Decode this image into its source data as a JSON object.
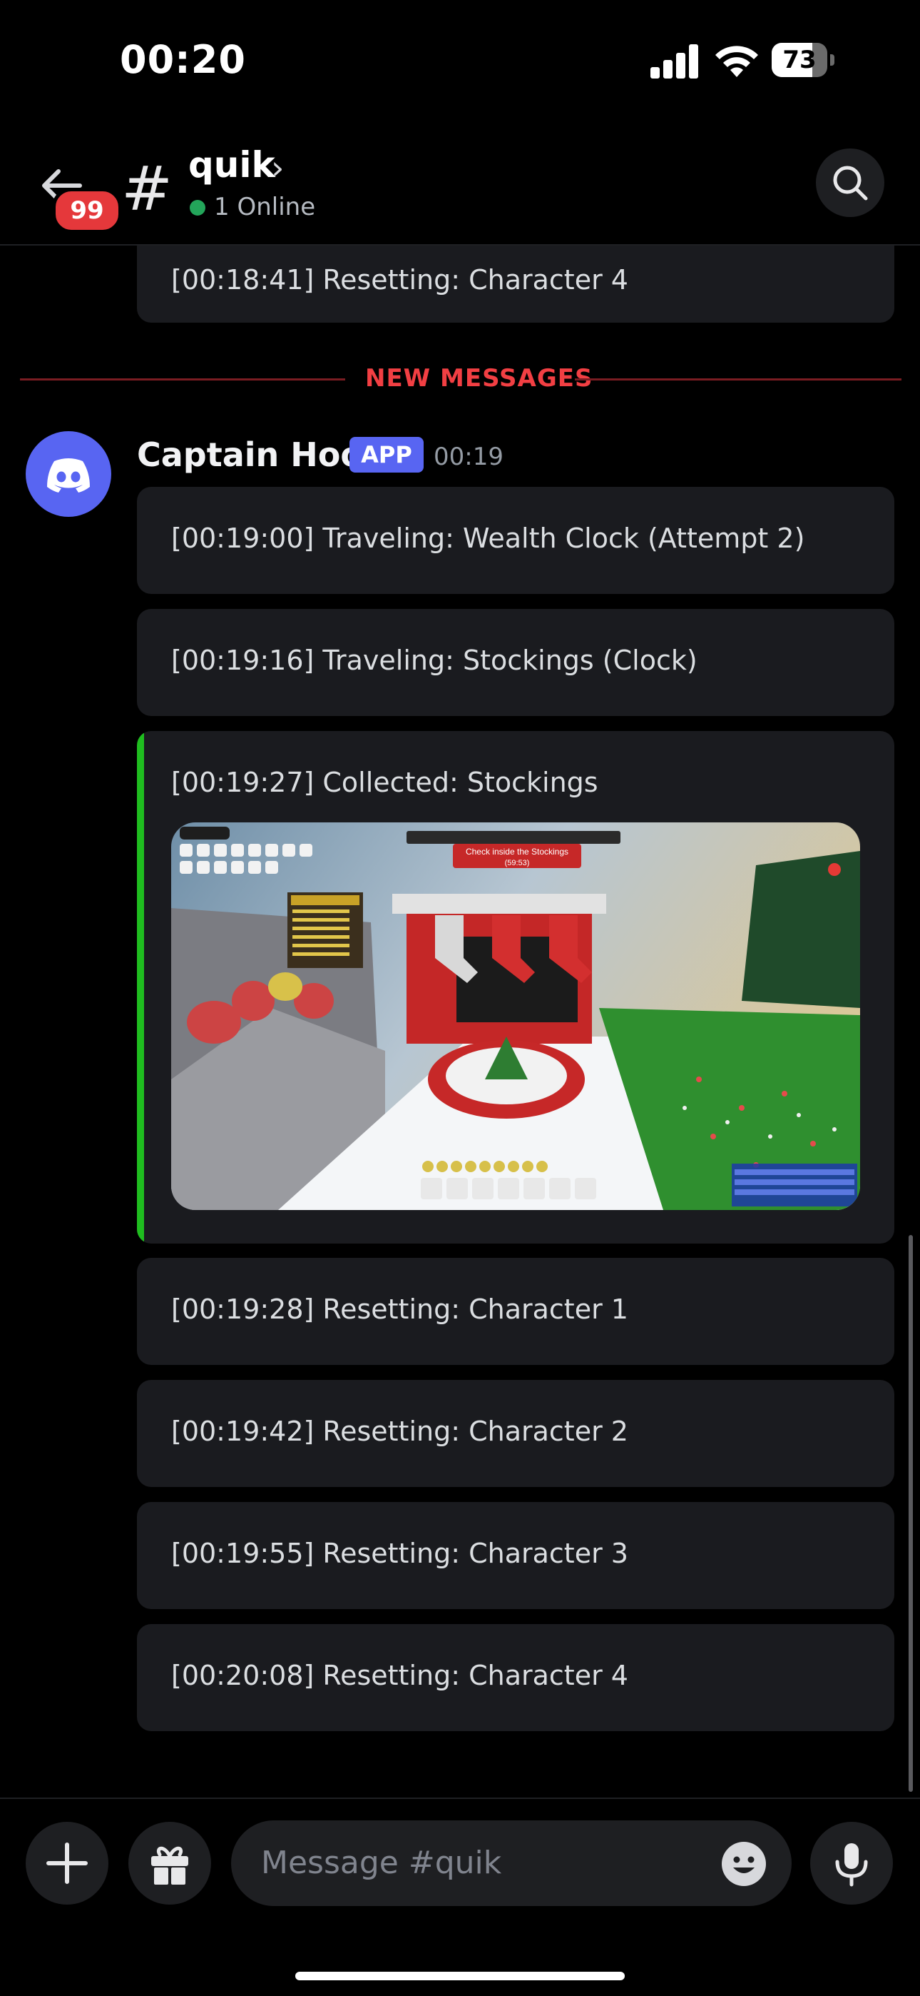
{
  "status_bar": {
    "time": "00:20",
    "battery": "73"
  },
  "header": {
    "back_badge": "99",
    "channel_hash": "#",
    "channel_name": "quik",
    "chevron": "›",
    "online_text": "1 Online",
    "icons": {
      "back": "arrow-left-icon",
      "search": "search-icon"
    }
  },
  "messages_above": [
    {
      "text": "[00:18:41] Resetting: Character 4"
    }
  ],
  "divider": {
    "label": "NEW MESSAGES"
  },
  "message_group": {
    "author": "Captain Hook",
    "tag": "APP",
    "time": "00:19",
    "avatar_icon": "discord-logo-icon",
    "messages": [
      {
        "text": "[00:19:00] Traveling: Wealth Clock (Attempt 2)"
      },
      {
        "text": "[00:19:16] Traveling: Stockings (Clock)"
      },
      {
        "text": "[00:19:27] Collected: Stockings",
        "accent": "#1fbd1f"
      },
      {
        "text": "[00:19:28] Resetting: Character 1"
      },
      {
        "text": "[00:19:42] Resetting: Character 2"
      },
      {
        "text": "[00:19:55] Resetting: Character 3"
      },
      {
        "text": "[00:20:08] Resetting: Character 4"
      }
    ],
    "embed": {
      "hud_text": "Check inside the Stockings",
      "hud_timer": "(59:53)",
      "board_title": "Top Brown Bear Helpers"
    }
  },
  "composer": {
    "placeholder": "Message #quik",
    "icons": {
      "add": "plus-icon",
      "gift": "gift-icon",
      "emoji": "emoji-icon",
      "mic": "microphone-icon"
    }
  },
  "colors": {
    "accent": "#5865f2",
    "danger": "#f23f43",
    "online": "#23a55a",
    "embed_bar": "#1fbd1f"
  }
}
